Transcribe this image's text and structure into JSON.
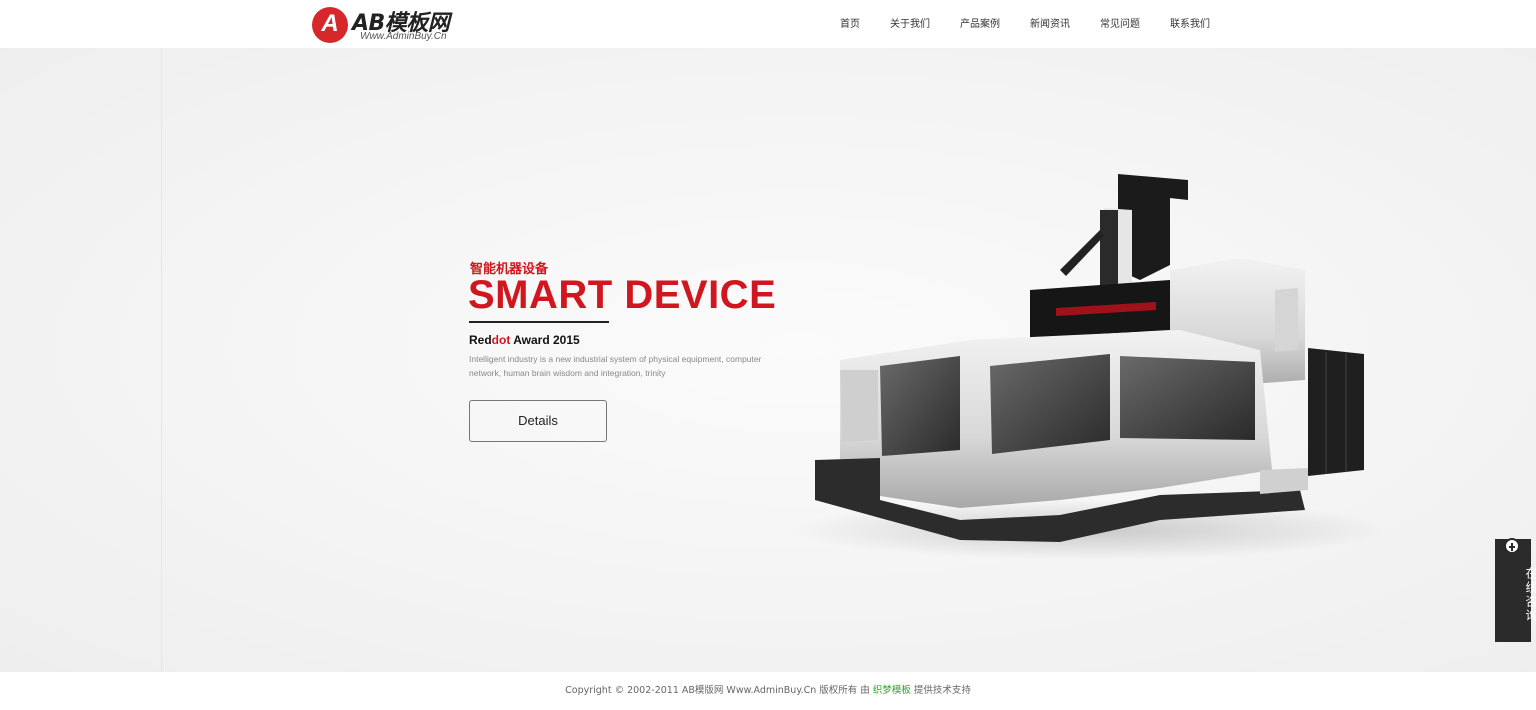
{
  "header": {
    "logo_mark": "A",
    "logo_title": "AB模板网",
    "logo_sub": "Www.AdminBuy.Cn",
    "nav": [
      "首页",
      "关于我们",
      "产品案例",
      "新闻资讯",
      "常见问题",
      "联系我们"
    ]
  },
  "hero": {
    "cn_title": "智能机器设备",
    "en_title": "SMART DEVICE",
    "award_prefix": "Red",
    "award_red": "dot",
    "award_suffix": " Award 2015",
    "desc": "Intelligent industry is a new industrial system of physical equipment, computer network, human brain wisdom and integration, trinity",
    "button": "Details"
  },
  "consult": {
    "label": "在线咨询"
  },
  "footer": {
    "copyright": "Copyright © 2002-2011 AB模版网 Www.AdminBuy.Cn 版权所有 由 ",
    "link": "织梦模板",
    "suffix": " 提供技术支持"
  },
  "colors": {
    "brand_red": "#d0161e",
    "dark": "#2b2b2b",
    "link_green": "#2aa52a"
  }
}
